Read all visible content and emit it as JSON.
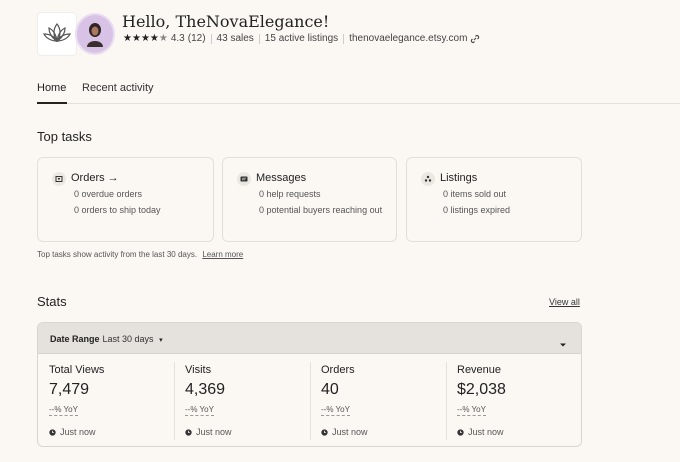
{
  "shop": {
    "greeting": "Hello, TheNovaElegance!",
    "rating": "4.3",
    "review_count": "(12)",
    "sales": "43 sales",
    "listings": "15 active listings",
    "url": "thenovaelegance.etsy.com"
  },
  "tabs": [
    {
      "label": "Home",
      "active": true
    },
    {
      "label": "Recent activity",
      "active": false
    }
  ],
  "top_tasks": {
    "title": "Top tasks",
    "cards": [
      {
        "heading": "Orders →",
        "icon": "orders-icon",
        "lines": [
          "0 overdue orders",
          "0 orders to ship today"
        ]
      },
      {
        "heading": "Messages",
        "icon": "messages-icon",
        "lines": [
          "0 help requests",
          "0 potential buyers reaching out"
        ]
      },
      {
        "heading": "Listings",
        "icon": "listings-icon",
        "lines": [
          "0 items sold out",
          "0 listings expired"
        ]
      }
    ],
    "footnote": "Top tasks show activity from the last 30 days.",
    "learn_more": "Learn more"
  },
  "stats": {
    "title": "Stats",
    "view_all": "View all",
    "date_range_label": "Date Range",
    "date_range_value": "Last 30 days",
    "items": [
      {
        "label": "Total Views",
        "value": "7,479",
        "yoy": "--% YoY",
        "time": "Just now"
      },
      {
        "label": "Visits",
        "value": "4,369",
        "yoy": "--% YoY",
        "time": "Just now"
      },
      {
        "label": "Orders",
        "value": "40",
        "yoy": "--% YoY",
        "time": "Just now"
      },
      {
        "label": "Revenue",
        "value": "$2,038",
        "yoy": "--% YoY",
        "time": "Just now"
      }
    ]
  }
}
